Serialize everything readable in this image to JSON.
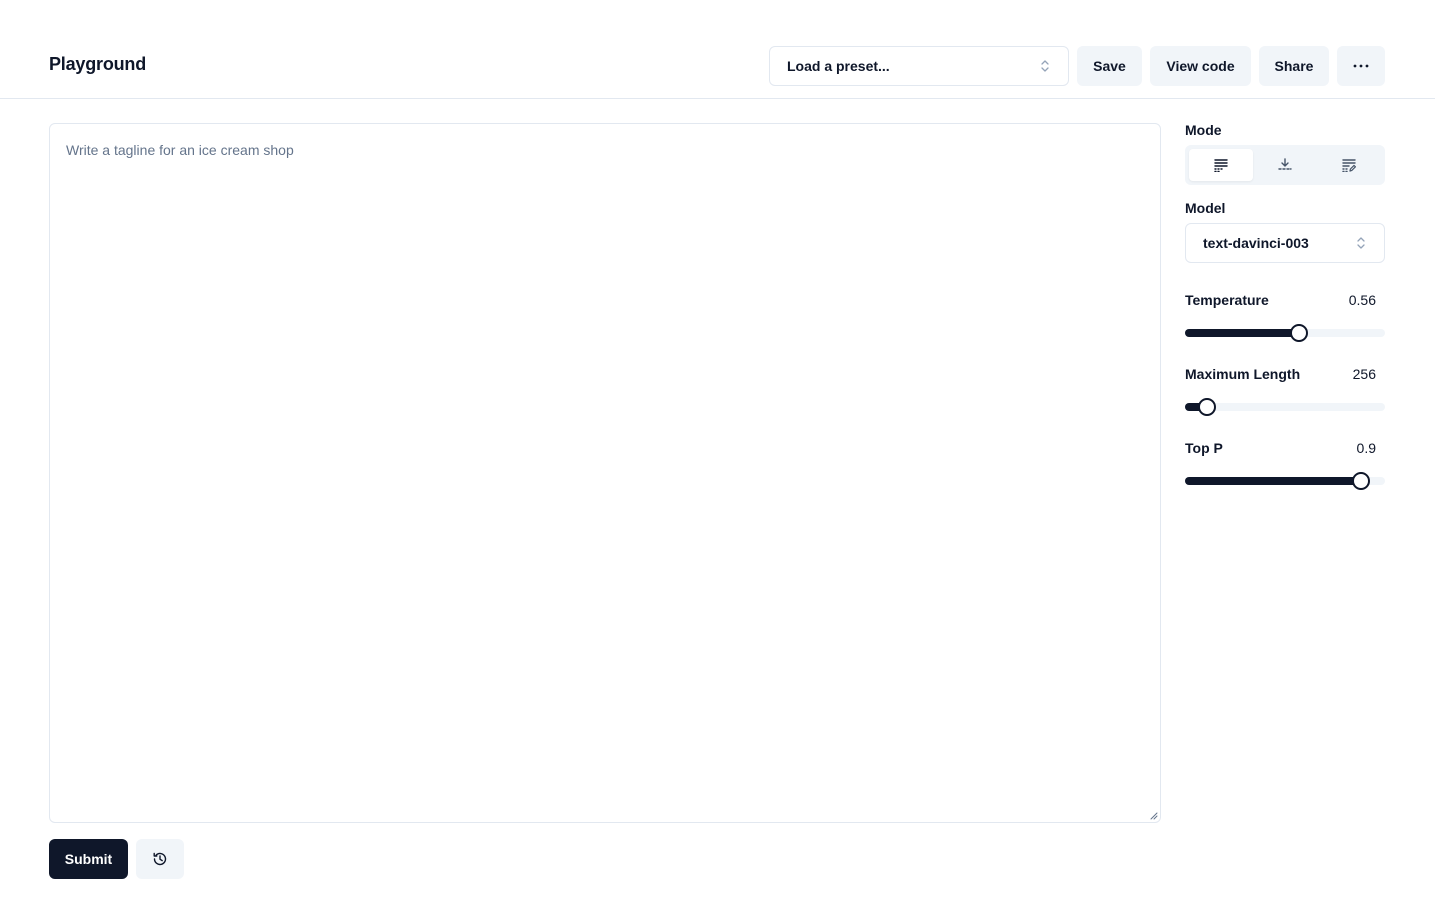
{
  "header": {
    "title": "Playground",
    "preset_placeholder": "Load a preset...",
    "save_label": "Save",
    "view_code_label": "View code",
    "share_label": "Share",
    "more_icon": "more-horizontal-icon"
  },
  "editor": {
    "placeholder": "Write a tagline for an ice cream shop",
    "value": ""
  },
  "actions": {
    "submit_label": "Submit",
    "history_icon": "history-icon"
  },
  "sidebar": {
    "mode": {
      "label": "Mode",
      "options": [
        "complete-icon",
        "insert-icon",
        "edit-icon"
      ],
      "selected_index": 0
    },
    "model": {
      "label": "Model",
      "value": "text-davinci-003"
    },
    "temperature": {
      "label": "Temperature",
      "value": "0.56",
      "fraction": 0.56
    },
    "max_length": {
      "label": "Maximum Length",
      "value": "256",
      "fraction": 0.1
    },
    "top_p": {
      "label": "Top P",
      "value": "0.9",
      "fraction": 0.87
    }
  },
  "colors": {
    "primary": "#0f172a",
    "muted_bg": "#f1f5f9",
    "border": "#e2e8f0",
    "placeholder": "#64748b"
  }
}
